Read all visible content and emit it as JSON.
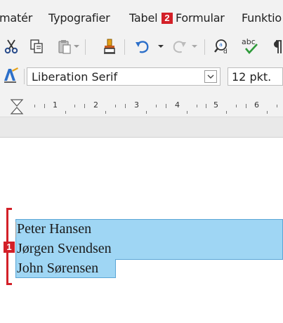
{
  "menu": {
    "items": [
      "matér",
      "Typografier",
      "Tabel",
      "Formular",
      "Funktio"
    ],
    "badge_table": "2"
  },
  "toolbar": {
    "icons": [
      "cut-icon",
      "copy-icon",
      "paste-icon",
      "clone-formatting-icon",
      "undo-icon",
      "redo-icon",
      "find-replace-icon",
      "spelling-icon",
      "formatting-marks-icon"
    ],
    "spelling_label": "abc"
  },
  "format": {
    "font_name": "Liberation Serif",
    "font_size": "12 pkt."
  },
  "ruler": {
    "numbers": [
      "1",
      "2",
      "3",
      "4",
      "5",
      "6"
    ]
  },
  "document": {
    "lines": [
      "Peter Hansen",
      "Jørgen Svendsen",
      "John Sørensen"
    ],
    "badge_selection": "1"
  },
  "colors": {
    "accent_red": "#d32028",
    "selection": "#9fd6f4"
  }
}
